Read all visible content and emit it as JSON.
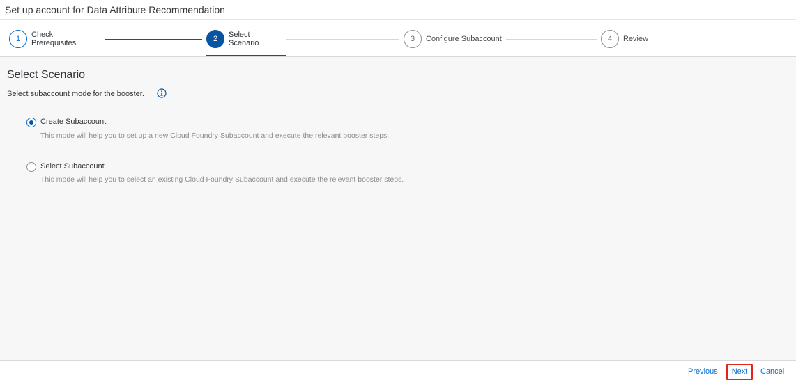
{
  "header": {
    "title": "Set up account for Data Attribute Recommendation"
  },
  "wizard": {
    "steps": [
      {
        "number": "1",
        "label_line1": "Check",
        "label_line2": "Prerequisites"
      },
      {
        "number": "2",
        "label_line1": "Select",
        "label_line2": "Scenario"
      },
      {
        "number": "3",
        "label": "Configure Subaccount"
      },
      {
        "number": "4",
        "label": "Review"
      }
    ],
    "active_step": 2
  },
  "content": {
    "title": "Select Scenario",
    "description": "Select subaccount mode for the booster.",
    "info_icon": "info-icon",
    "options": [
      {
        "label": "Create Subaccount",
        "description": "This mode will help you to set up a new Cloud Foundry Subaccount and execute the relevant booster steps.",
        "selected": true
      },
      {
        "label": "Select Subaccount",
        "description": "This mode will help you to select an existing Cloud Foundry Subaccount and execute the relevant booster steps.",
        "selected": false
      }
    ]
  },
  "footer": {
    "previous_label": "Previous",
    "next_label": "Next",
    "cancel_label": "Cancel"
  },
  "colors": {
    "accent": "#0854a0",
    "link": "#0a6ed1",
    "highlight_border": "#e0261b",
    "background": "#f7f7f7"
  }
}
